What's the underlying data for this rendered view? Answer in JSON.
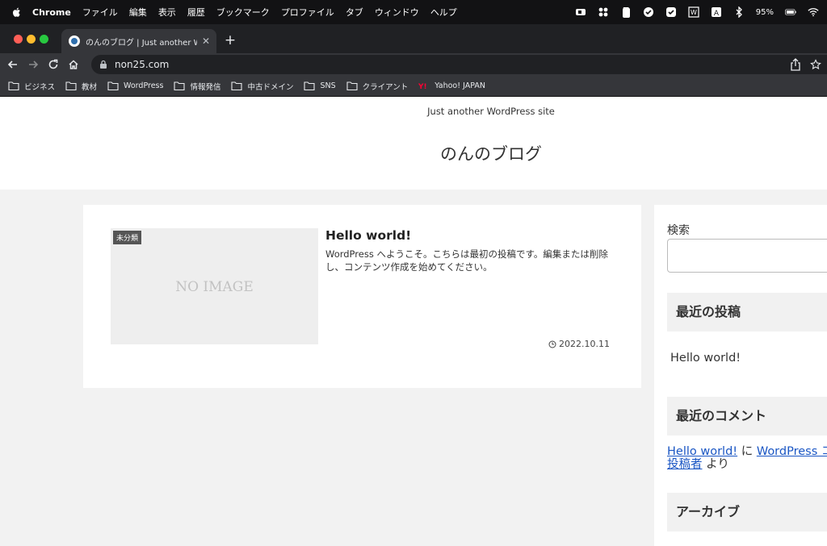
{
  "menubar": {
    "app": "Chrome",
    "items": [
      "ファイル",
      "編集",
      "表示",
      "履歴",
      "ブックマーク",
      "プロファイル",
      "タブ",
      "ウィンドウ",
      "ヘルプ"
    ],
    "battery": "95%"
  },
  "tab": {
    "title": "のんのブログ | Just another WordPress site"
  },
  "address": {
    "url": "non25.com"
  },
  "bookmarks": [
    "ビジネス",
    "教材",
    "WordPress",
    "情報発信",
    "中古ドメイン",
    "SNS",
    "クライアント",
    "Yahoo! JAPAN"
  ],
  "site": {
    "tagline": "Just another WordPress site",
    "title": "のんのブログ"
  },
  "post": {
    "category": "未分類",
    "thumbnail_text": "NO IMAGE",
    "title": "Hello world!",
    "excerpt": "WordPress へようこそ。こちらは最初の投稿です。編集または削除し、コンテンツ作成を始めてください。",
    "date": "2022.10.11"
  },
  "sidebar": {
    "search_label": "検索",
    "search_value": "",
    "recent_posts_heading": "最近の投稿",
    "recent_post": "Hello world!",
    "recent_comments_heading": "最近のコメント",
    "comment": {
      "post_link": "Hello world!",
      "connector": " に ",
      "author_link_part1": "WordPress コ",
      "author_link_part2": "投稿者",
      "suffix": " より"
    },
    "archive_heading": "アーカイブ"
  },
  "colors": {
    "link": "#1a56c4",
    "page_bg": "#f2f2f2",
    "chrome_dark": "#202124"
  }
}
